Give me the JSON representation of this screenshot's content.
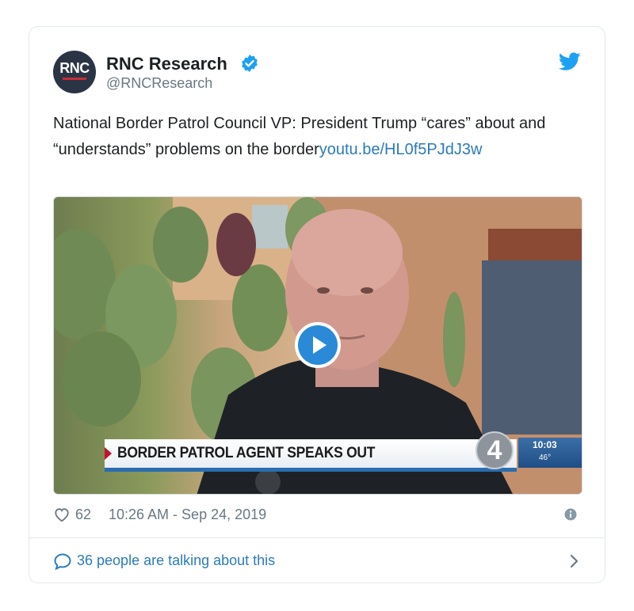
{
  "author": {
    "name": "RNC Research",
    "handle": "@RNCResearch",
    "avatar_text": "RNC"
  },
  "tweet": {
    "text_prefix": "National Border Patrol Council VP: President Trump “cares” about and “understands” problems on the border",
    "link": "youtu.be/HL0f5PJdJ3w"
  },
  "media": {
    "lower_third_text": "BORDER PATROL AGENT SPEAKS OUT",
    "channel_number": "4",
    "clock_time": "10:03",
    "clock_temp": "46°"
  },
  "footer": {
    "like_count": "62",
    "timestamp": "10:26 AM - Sep 24, 2019",
    "talking": "36 people are talking about this"
  },
  "icons": {
    "verified": "verified-badge-icon",
    "twitter": "twitter-bird-icon",
    "heart": "heart-icon",
    "info": "info-icon",
    "comment": "speech-bubble-icon",
    "chevron": "chevron-right-icon",
    "play": "play-icon"
  },
  "colors": {
    "link": "#2b7bb9",
    "verified": "#1da1f2",
    "secondary_text": "#697882",
    "play": "#2a8ad8"
  }
}
